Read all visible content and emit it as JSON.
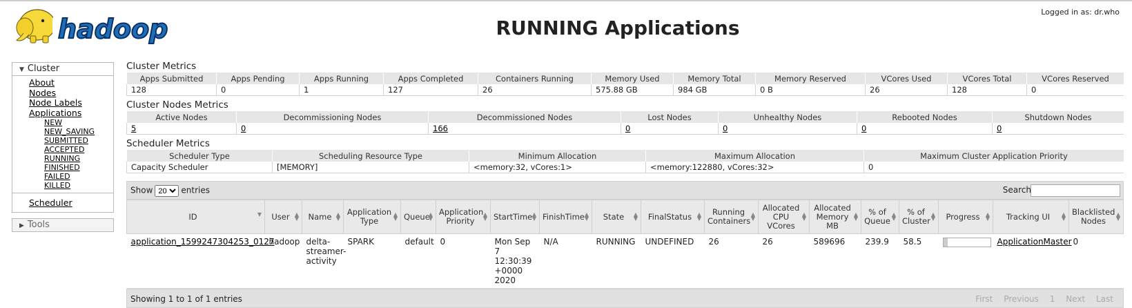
{
  "header": {
    "logo_text": "hadoop",
    "title": "RUNNING Applications",
    "logged_in": "Logged in as: dr.who"
  },
  "sidebar": {
    "cluster_label": "Cluster",
    "cluster_links": [
      "About",
      "Nodes",
      "Node Labels",
      "Applications"
    ],
    "app_states": [
      "NEW",
      "NEW_SAVING",
      "SUBMITTED",
      "ACCEPTED",
      "RUNNING",
      "FINISHED",
      "FAILED",
      "KILLED"
    ],
    "scheduler_label": "Scheduler",
    "tools_label": "Tools"
  },
  "cluster_metrics": {
    "title": "Cluster Metrics",
    "headers": [
      "Apps Submitted",
      "Apps Pending",
      "Apps Running",
      "Apps Completed",
      "Containers Running",
      "Memory Used",
      "Memory Total",
      "Memory Reserved",
      "VCores Used",
      "VCores Total",
      "VCores Reserved"
    ],
    "values": [
      "128",
      "0",
      "1",
      "127",
      "26",
      "575.88 GB",
      "984 GB",
      "0 B",
      "26",
      "128",
      "0"
    ]
  },
  "node_metrics": {
    "title": "Cluster Nodes Metrics",
    "headers": [
      "Active Nodes",
      "Decommissioning Nodes",
      "Decommissioned Nodes",
      "Lost Nodes",
      "Unhealthy Nodes",
      "Rebooted Nodes",
      "Shutdown Nodes"
    ],
    "values": [
      "5",
      "0",
      "166",
      "0",
      "0",
      "0",
      "0"
    ]
  },
  "scheduler_metrics": {
    "title": "Scheduler Metrics",
    "headers": [
      "Scheduler Type",
      "Scheduling Resource Type",
      "Minimum Allocation",
      "Maximum Allocation",
      "Maximum Cluster Application Priority"
    ],
    "values": [
      "Capacity Scheduler",
      "[MEMORY]",
      "<memory:32, vCores:1>",
      "<memory:122880, vCores:32>",
      "0"
    ]
  },
  "apps_table": {
    "show_label": "Show",
    "page_size": "20",
    "entries_label": "entries",
    "search_label": "Search:",
    "search_value": "",
    "columns": [
      "ID",
      "User",
      "Name",
      "Application Type",
      "Queue",
      "Application Priority",
      "StartTime",
      "FinishTime",
      "State",
      "FinalStatus",
      "Running Containers",
      "Allocated CPU VCores",
      "Allocated Memory MB",
      "% of Queue",
      "% of Cluster",
      "Progress",
      "Tracking UI",
      "Blacklisted Nodes"
    ],
    "rows": [
      {
        "id": "application_1599247304253_0127",
        "user": "hadoop",
        "name": "delta-streamer-activity",
        "type": "SPARK",
        "queue": "default",
        "priority": "0",
        "start_time": "Mon Sep 7 12:30:39 +0000 2020",
        "finish_time": "N/A",
        "state": "RUNNING",
        "final_status": "UNDEFINED",
        "running_containers": "26",
        "vcores": "26",
        "memory_mb": "589696",
        "pct_queue": "239.9",
        "pct_cluster": "58.5",
        "progress_pct": 10,
        "tracking_ui": "ApplicationMaster",
        "blacklisted": "0"
      }
    ],
    "showing": "Showing 1 to 1 of 1 entries",
    "pager": [
      "First",
      "Previous",
      "1",
      "Next",
      "Last"
    ]
  }
}
